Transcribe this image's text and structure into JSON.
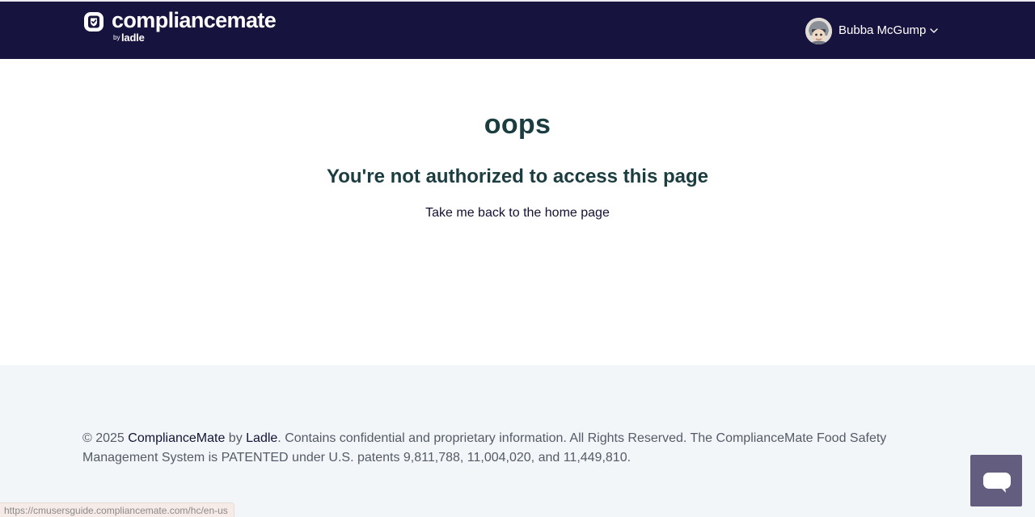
{
  "header": {
    "logo": {
      "wordmark": "compliancemate",
      "by": "by",
      "brand": "ladle"
    },
    "user": {
      "name": "Bubba McGump"
    }
  },
  "main": {
    "heading": "oops",
    "message": "You're not authorized to access this page",
    "home_link": "Take me back to the home page"
  },
  "footer": {
    "copyright_prefix": "© 2025 ",
    "company": "ComplianceMate",
    "by": " by ",
    "parent": "Ladle",
    "rest": ". Contains confidential and proprietary information. All Rights Reserved. The ComplianceMate Food Safety Management System is PATENTED under U.S. patents 9,811,788, 11,004,020, and 11,449,810."
  },
  "status_bar": {
    "url": "https://cmusersguide.compliancemate.com/hc/en-us"
  },
  "icons": {
    "logo": "shield-badge-icon",
    "user_menu": "chevron-down-icon",
    "chat": "chat-bubble-icon"
  },
  "colors": {
    "header_bg": "#16133f",
    "heading": "#1c3d40",
    "footer_bg": "#f3f6f9",
    "chat_button": "#635e80"
  }
}
